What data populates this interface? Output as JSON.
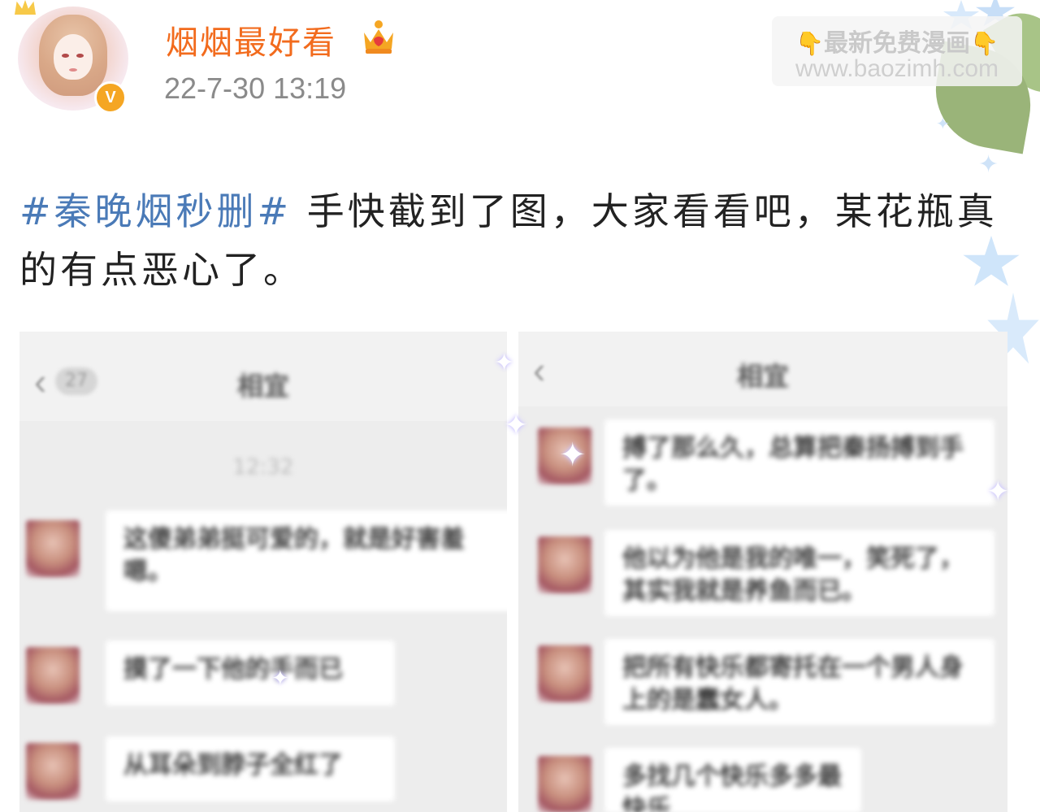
{
  "post": {
    "author": {
      "name": "烟烟最好看",
      "verified_mark": "V"
    },
    "time": "22-7-30 13:19",
    "hashtag": "#秦晚烟秒删#",
    "text": " 手快截到了图，大家看看吧，某花瓶真的有点恶心了。"
  },
  "watermark": {
    "line1": "最新免费漫画",
    "line2": "www.baozimh.com",
    "hand_icon": "👇"
  },
  "screenshots": {
    "left": {
      "title": "相宜",
      "back_count": "27",
      "time": "12:32",
      "messages": [
        "这傻弟弟挺可爱的，就是好害羞嗯。",
        "摸了一下他的手而已",
        "从耳朵到脖子全红了"
      ]
    },
    "right": {
      "title": "相宜",
      "messages": [
        "搏了那么久，总算把秦扬搏到手了。",
        "他以为他是我的唯一，笑死了，其实我就是养鱼而已。",
        "把所有快乐都寄托在一个男人身上的是蠢女人。",
        "多找几个快乐多多最快乐"
      ]
    }
  },
  "colors": {
    "username": "#f26b1d",
    "hashtag": "#4a7ab7",
    "verified": "#f5a623"
  }
}
